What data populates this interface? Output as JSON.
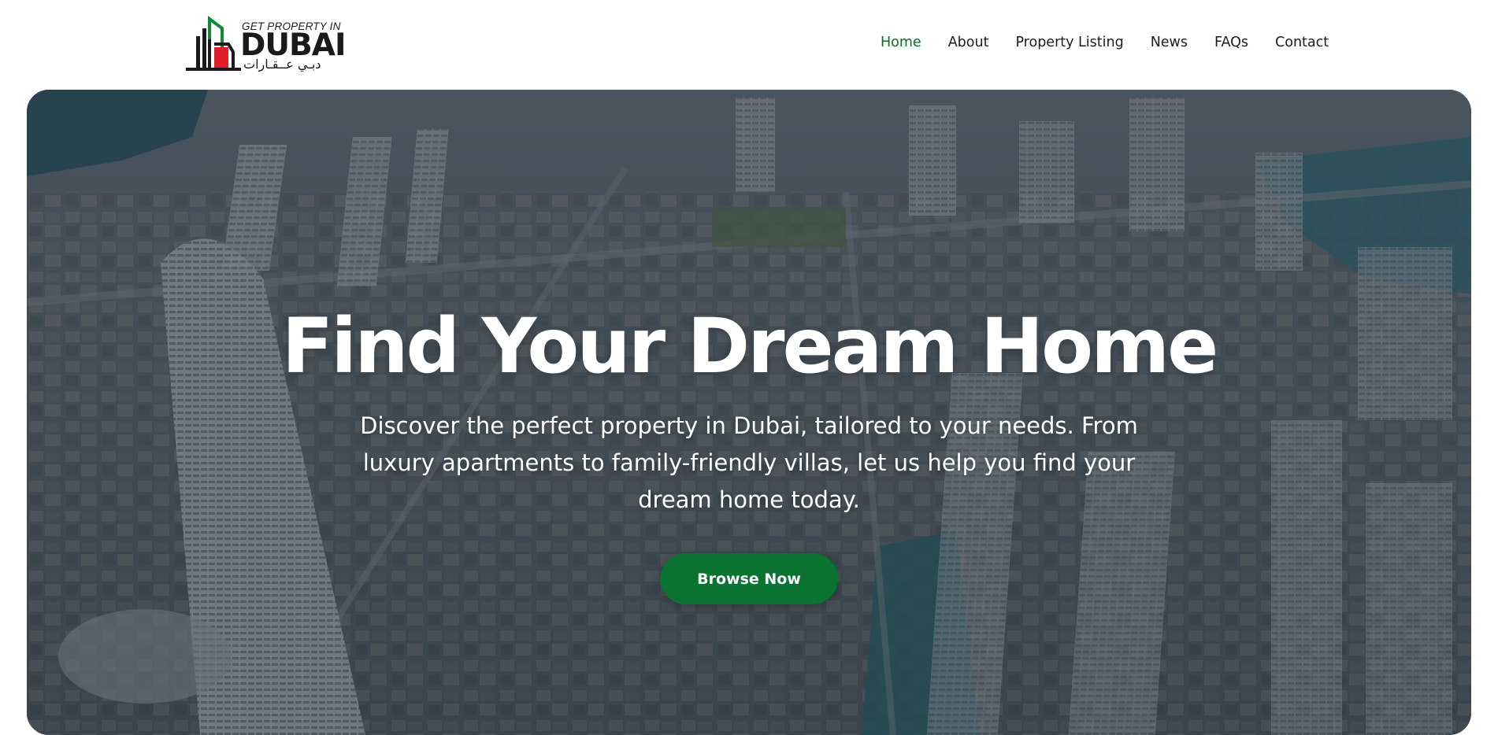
{
  "brand": {
    "tagline": "GET PROPERTY IN",
    "name": "DUBAI",
    "arabic": "دبـي عــقـارات",
    "colors": {
      "green": "#0c8a3a",
      "red": "#e11d2a",
      "dark": "#1a1a1a"
    }
  },
  "nav": {
    "items": [
      {
        "label": "Home",
        "active": true
      },
      {
        "label": "About",
        "active": false
      },
      {
        "label": "Property Listing",
        "active": false
      },
      {
        "label": "News",
        "active": false
      },
      {
        "label": "FAQs",
        "active": false
      },
      {
        "label": "Contact",
        "active": false
      }
    ],
    "active_color": "#0c6b2d"
  },
  "hero": {
    "title": "Find Your Dream Home",
    "subtitle": "Discover the perfect property in Dubai, tailored to your needs. From luxury apartments to family-friendly villas, let us help you find your dream home today.",
    "cta_label": "Browse Now",
    "cta_color": "#0a7332",
    "background": "aerial-city-skyline-image"
  }
}
